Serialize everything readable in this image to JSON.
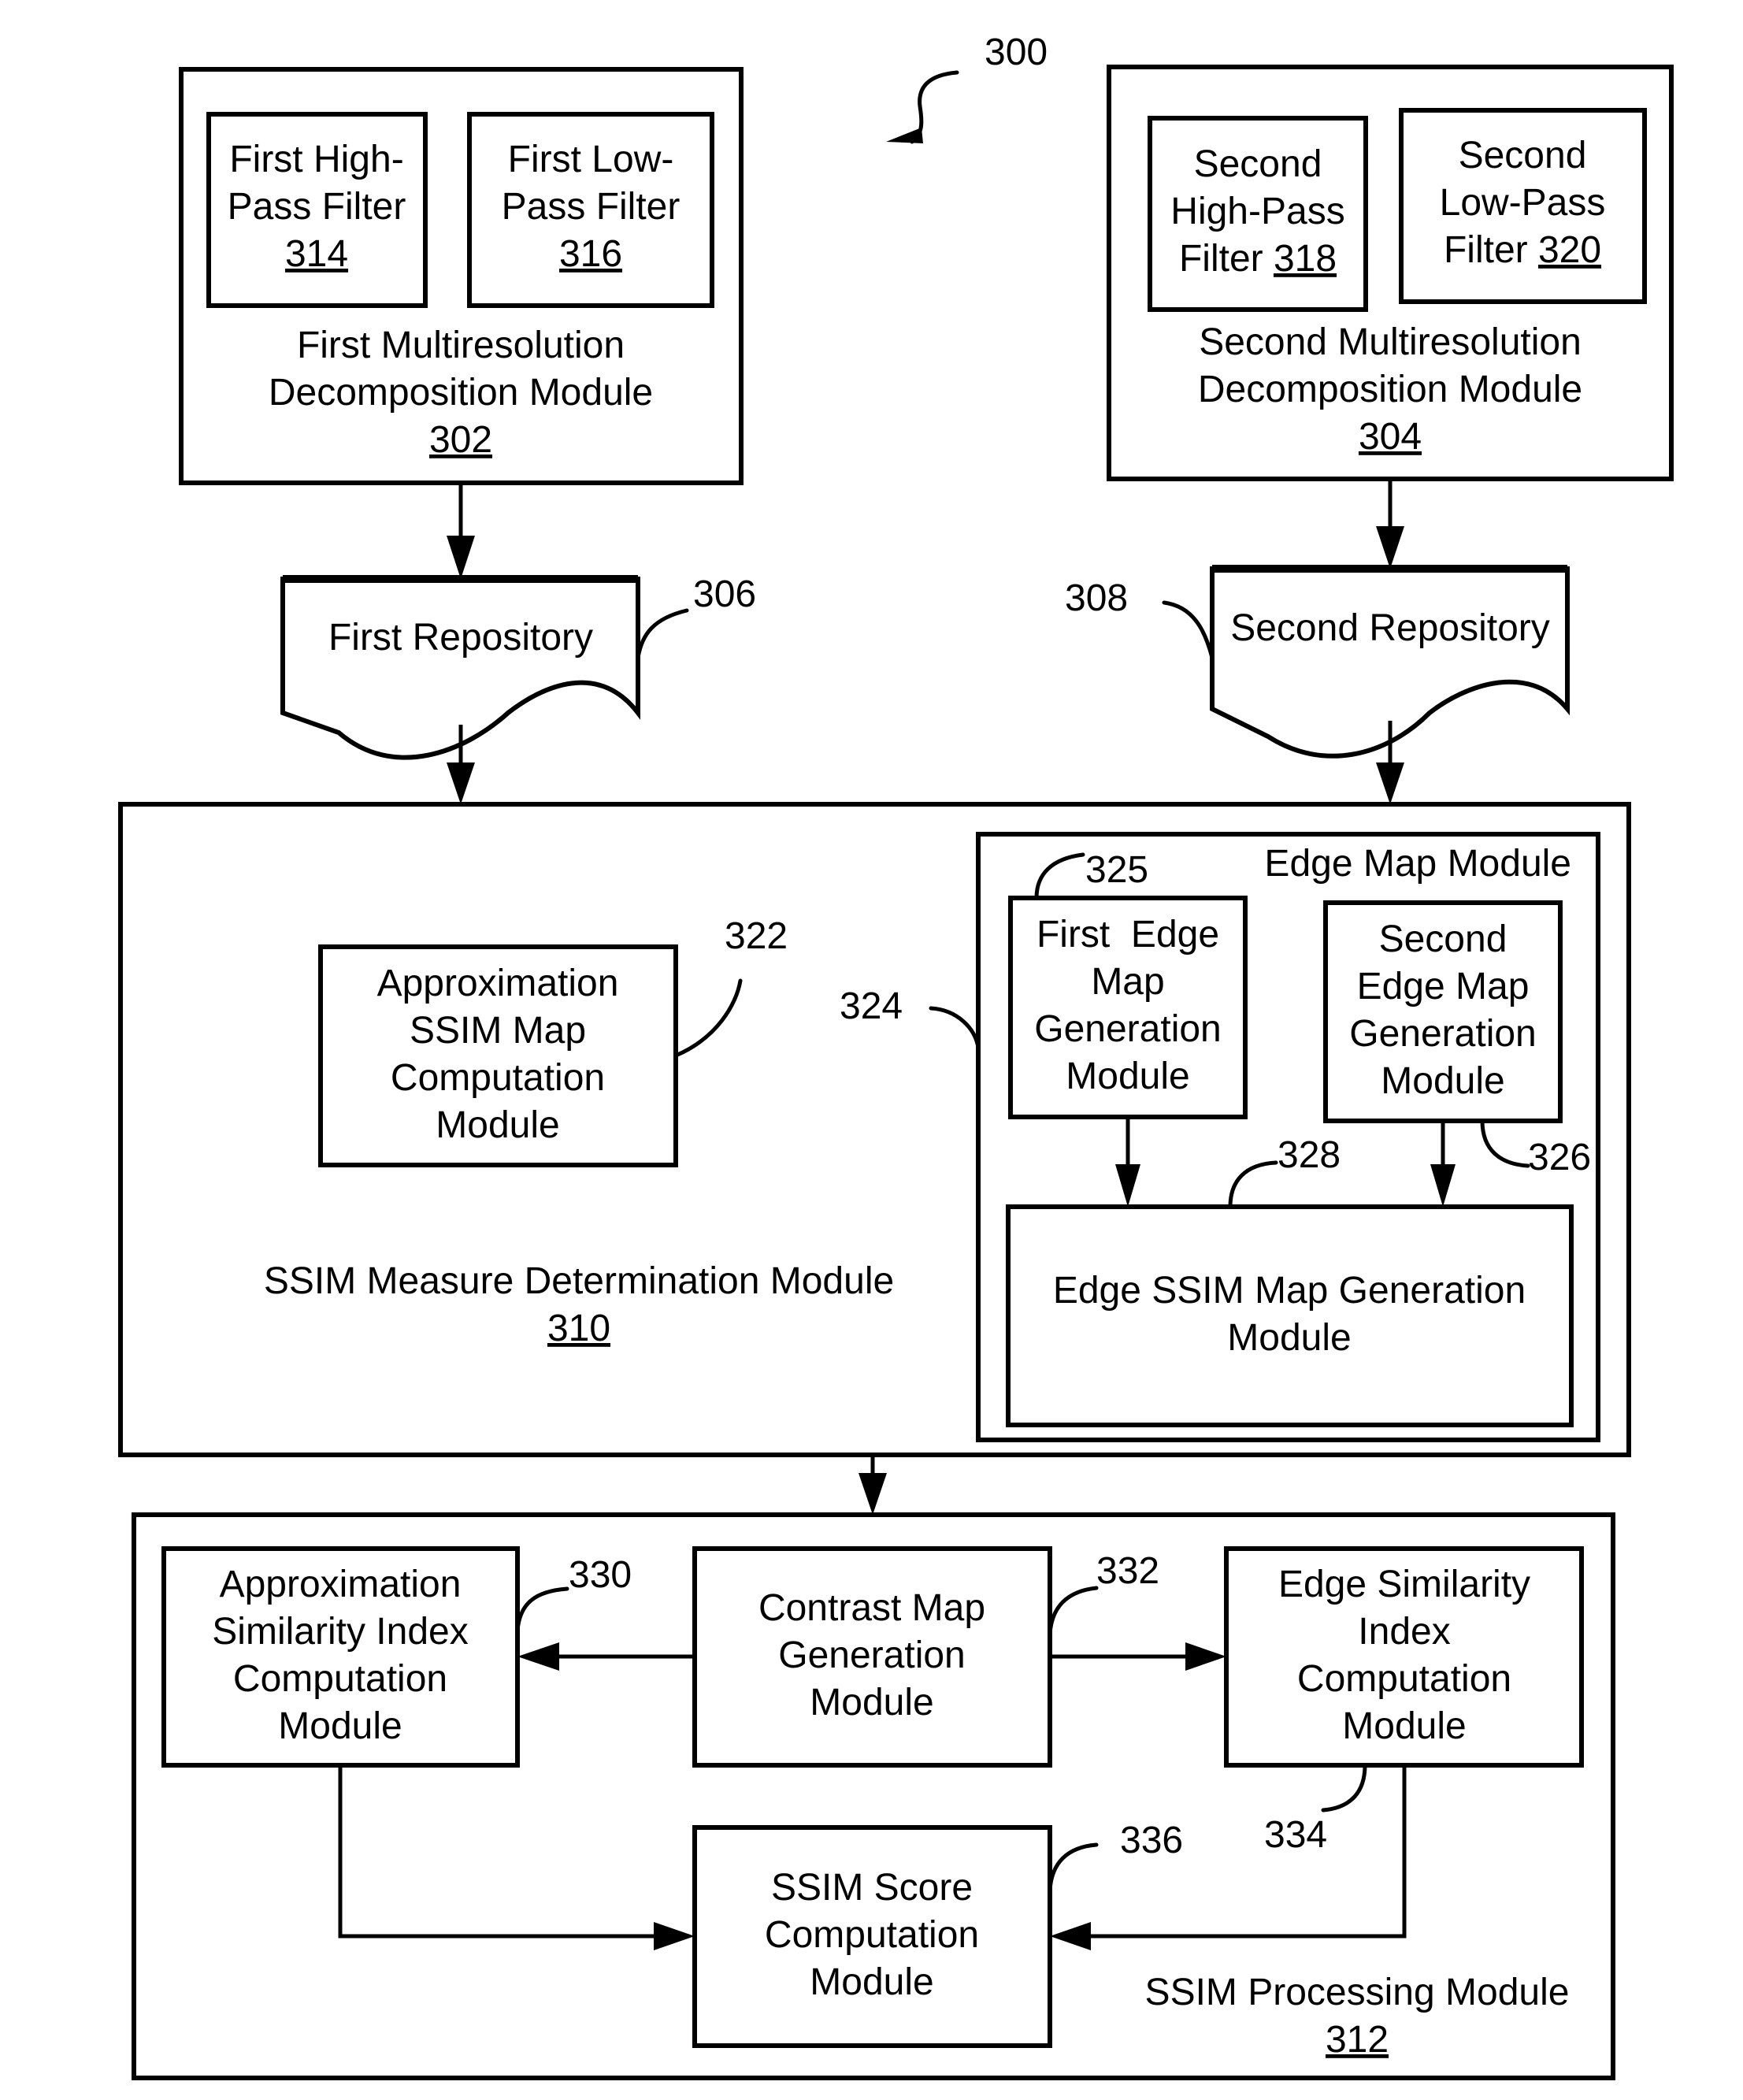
{
  "figure": {
    "reference": "300"
  },
  "modules": {
    "first_multires": {
      "lines": [
        "First Multiresolution",
        "Decomposition Module"
      ],
      "ref": "302",
      "high_pass": {
        "lines": [
          "First High-",
          "Pass Filter"
        ],
        "ref": "314"
      },
      "low_pass": {
        "lines": [
          "First Low-",
          "Pass Filter"
        ],
        "ref": "316"
      }
    },
    "second_multires": {
      "lines": [
        "Second Multiresolution",
        "Decomposition Module"
      ],
      "ref": "304",
      "high_pass": {
        "lines": [
          "Second",
          "High-Pass"
        ],
        "last_prefix": "Filter ",
        "ref": "318"
      },
      "low_pass": {
        "lines": [
          "Second",
          "Low-Pass"
        ],
        "last_prefix": "Filter ",
        "ref": "320"
      }
    },
    "first_repository": {
      "label": "First Repository",
      "ref": "306"
    },
    "second_repository": {
      "label": "Second Repository",
      "ref": "308"
    },
    "ssim_measure": {
      "label": "SSIM Measure Determination Module",
      "ref": "310",
      "approx_ssim_map": {
        "lines": [
          "Approximation",
          "SSIM Map",
          "Computation",
          "Module"
        ],
        "ref": "322"
      },
      "edge_map_module": {
        "label": "Edge Map Module",
        "ref": "324",
        "first_edge": {
          "lines": [
            "First  Edge",
            "Map",
            "Generation",
            "Module"
          ],
          "ref": "325"
        },
        "second_edge": {
          "lines": [
            "Second",
            "Edge Map",
            "Generation",
            "Module"
          ],
          "ref": "326"
        },
        "edge_ssim": {
          "lines": [
            "Edge SSIM Map Generation",
            "Module"
          ],
          "ref": "328"
        }
      }
    },
    "ssim_processing": {
      "label": "SSIM Processing Module",
      "ref": "312",
      "approx_similarity": {
        "lines": [
          "Approximation",
          "Similarity Index",
          "Computation",
          "Module"
        ],
        "ref": "330"
      },
      "contrast_map": {
        "lines": [
          "Contrast Map",
          "Generation",
          "Module"
        ],
        "ref": "332"
      },
      "edge_similarity": {
        "lines": [
          "Edge Similarity",
          "Index",
          "Computation",
          "Module"
        ],
        "ref": "334"
      },
      "ssim_score": {
        "lines": [
          "SSIM Score",
          "Computation",
          "Module"
        ],
        "ref": "336"
      }
    }
  }
}
